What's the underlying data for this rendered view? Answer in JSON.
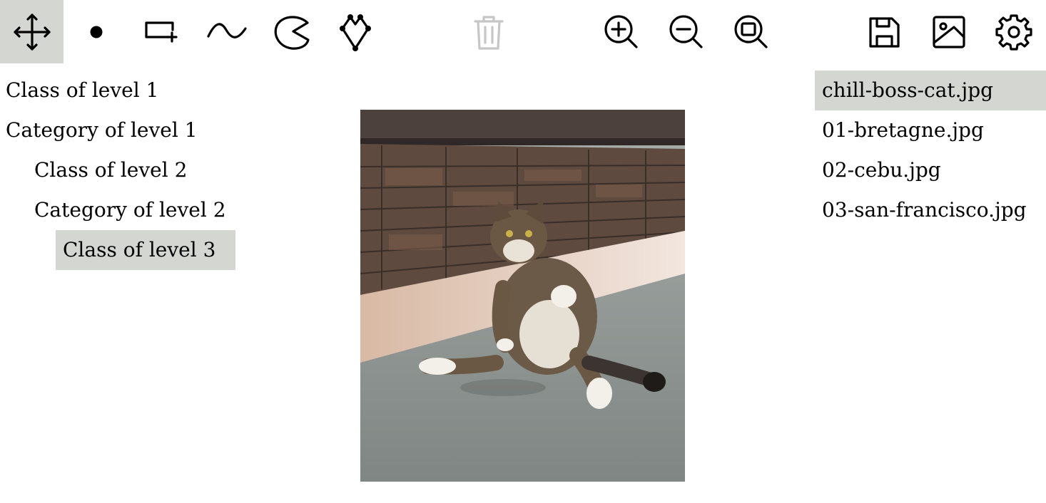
{
  "toolbar": {
    "tools": [
      {
        "icon": "move-icon",
        "label": "Move"
      },
      {
        "icon": "point-icon",
        "label": "Point"
      },
      {
        "icon": "add-rectangle-icon",
        "label": "Rectangle"
      },
      {
        "icon": "line-icon",
        "label": "Line"
      },
      {
        "icon": "polygon-icon",
        "label": "Polygon"
      },
      {
        "icon": "polyline-icon",
        "label": "Polyline"
      },
      {
        "icon": "trash-icon",
        "label": "Delete"
      },
      {
        "icon": "zoom-in-icon",
        "label": "Zoom in"
      },
      {
        "icon": "zoom-out-icon",
        "label": "Zoom out"
      },
      {
        "icon": "zoom-fit-icon",
        "label": "Zoom to fit"
      },
      {
        "icon": "save-icon",
        "label": "Save"
      },
      {
        "icon": "image-icon",
        "label": "Image"
      },
      {
        "icon": "gear-icon",
        "label": "Settings"
      }
    ],
    "active_tool": "Move",
    "disabled_tool": "Delete"
  },
  "categories": {
    "items": [
      {
        "label": "Class of level 1",
        "level": 1,
        "selected": false
      },
      {
        "label": "Category of level 1",
        "level": 1,
        "selected": false
      },
      {
        "label": "Class of level 2",
        "level": 2,
        "selected": false
      },
      {
        "label": "Category of level 2",
        "level": 2,
        "selected": false
      },
      {
        "label": "Class of level 3",
        "level": 3,
        "selected": true
      }
    ]
  },
  "files": {
    "items": [
      {
        "label": "chill-boss-cat.jpg",
        "selected": true
      },
      {
        "label": "01-bretagne.jpg",
        "selected": false
      },
      {
        "label": "02-cebu.jpg",
        "selected": false
      },
      {
        "label": "03-san-francisco.jpg",
        "selected": false
      }
    ]
  },
  "colors": {
    "selection_background": "#d4d6d2",
    "disabled_icon": "#c8c8c8"
  }
}
